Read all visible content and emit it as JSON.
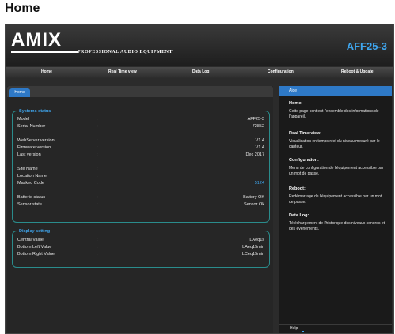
{
  "page_heading": "Home",
  "header": {
    "logo_text": "AMIX",
    "tagline": "PROFESSIONAL AUDIO EQUIPMENT",
    "device_name": "AFF25-3"
  },
  "nav": {
    "items": [
      "Home",
      "Real Time view",
      "Data Log",
      "Configuration",
      "Reboot & Update"
    ]
  },
  "main": {
    "tab_label": "Home",
    "system_status": {
      "title": "Systems status",
      "separator": ":",
      "rows": [
        {
          "label": "Model",
          "value": "AFF25-3"
        },
        {
          "label": "Serial Number",
          "value": "72852"
        },
        {
          "label": "WebServer version",
          "value": "V1.4"
        },
        {
          "label": "Firmware version",
          "value": "V1.4"
        },
        {
          "label": "Last version",
          "value": "Dec 2017"
        },
        {
          "label": "Site Name",
          "value": ""
        },
        {
          "label": "Location Name",
          "value": ""
        },
        {
          "label": "Masked Code",
          "value": "5124"
        },
        {
          "label": "Batterie status",
          "value": "Battery OK"
        },
        {
          "label": "Sensor state",
          "value": "Sensor Ok"
        }
      ]
    },
    "display_setting": {
      "title": "Display setting",
      "separator": ":",
      "rows": [
        {
          "label": "Central Value",
          "value": "LAeq1s"
        },
        {
          "label": "Bottom Left Value",
          "value": "LAeq15min"
        },
        {
          "label": "Bottom Right Value",
          "value": "LCeq15min"
        }
      ]
    }
  },
  "aside": {
    "title": "Aide",
    "sections": [
      {
        "heading": "Home:",
        "text": "Cette page contient l'ensemble des informations de l'appareil."
      },
      {
        "heading": "Real Time view:",
        "text": "Visualisation en temps réel du niveau mesuré par le capteur."
      },
      {
        "heading": "Configuration:",
        "text": "Menu de configuration de l'équipement accessible par un mot de passe."
      },
      {
        "heading": "Reboot:",
        "text": "Redémarrage de l'équipement accessible par un mot de passe."
      },
      {
        "heading": "Data Log:",
        "text": "Téléchargement de l'historique des niveaux sonores et des événements."
      }
    ],
    "footer_toggle": "+",
    "footer_label": "Help"
  },
  "colors": {
    "accent_blue": "#3fa7f0",
    "tab_blue": "#2e79c7",
    "panel_border": "#2a8c8c",
    "background_dark": "#262626"
  }
}
